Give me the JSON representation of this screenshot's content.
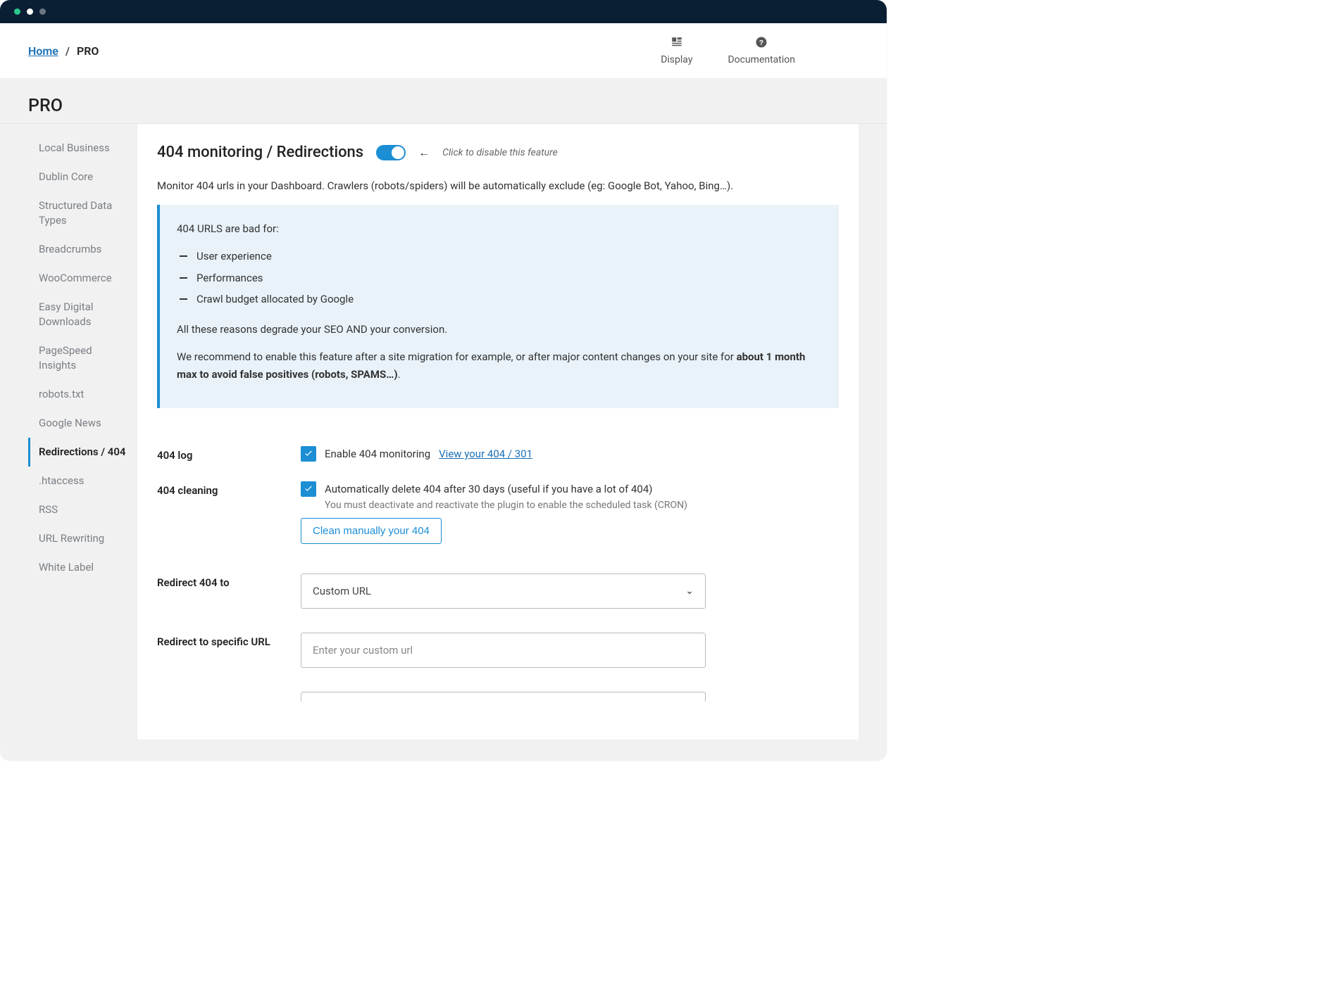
{
  "breadcrumb": {
    "home": "Home",
    "current": "PRO"
  },
  "topnav": {
    "display": "Display",
    "documentation": "Documentation"
  },
  "page_title": "PRO",
  "sidebar": {
    "items": [
      {
        "label": "Local Business"
      },
      {
        "label": "Dublin Core"
      },
      {
        "label": "Structured Data Types"
      },
      {
        "label": "Breadcrumbs"
      },
      {
        "label": "WooCommerce"
      },
      {
        "label": "Easy Digital Downloads"
      },
      {
        "label": "PageSpeed Insights"
      },
      {
        "label": "robots.txt"
      },
      {
        "label": "Google News"
      },
      {
        "label": "Redirections / 404"
      },
      {
        "label": ".htaccess"
      },
      {
        "label": "RSS"
      },
      {
        "label": "URL Rewriting"
      },
      {
        "label": "White Label"
      }
    ],
    "active_index": 9
  },
  "header": {
    "title": "404 monitoring / Redirections",
    "toggle_hint": "Click to disable this feature",
    "toggle_on": true
  },
  "intro": "Monitor 404 urls in your Dashboard. Crawlers (robots/spiders) will be automatically exclude (eg: Google Bot, Yahoo, Bing…).",
  "callout": {
    "lead": "404 URLS are bad for:",
    "bullets": [
      "User experience",
      "Performances",
      "Crawl budget allocated by Google"
    ],
    "line2": "All these reasons degrade your SEO AND your conversion.",
    "rec_prefix": "We recommend to enable this feature after a site migration for example, or after major content changes on your site for ",
    "rec_bold": "about 1 month max to avoid false positives (robots, SPAMS…)",
    "rec_suffix": "."
  },
  "log": {
    "label": "404 log",
    "checkbox_label": "Enable 404 monitoring",
    "checked": true,
    "view_link": "View your 404 / 301"
  },
  "cleaning": {
    "label": "404 cleaning",
    "checkbox_label": "Automatically delete 404 after 30 days (useful if you have a lot of 404)",
    "checked": true,
    "note": "You must deactivate and reactivate the plugin to enable the scheduled task (CRON)",
    "button": "Clean manually your 404"
  },
  "redirect_to": {
    "label": "Redirect 404 to",
    "selected": "Custom URL"
  },
  "redirect_url": {
    "label": "Redirect to specific URL",
    "placeholder": "Enter your custom url",
    "value": ""
  }
}
